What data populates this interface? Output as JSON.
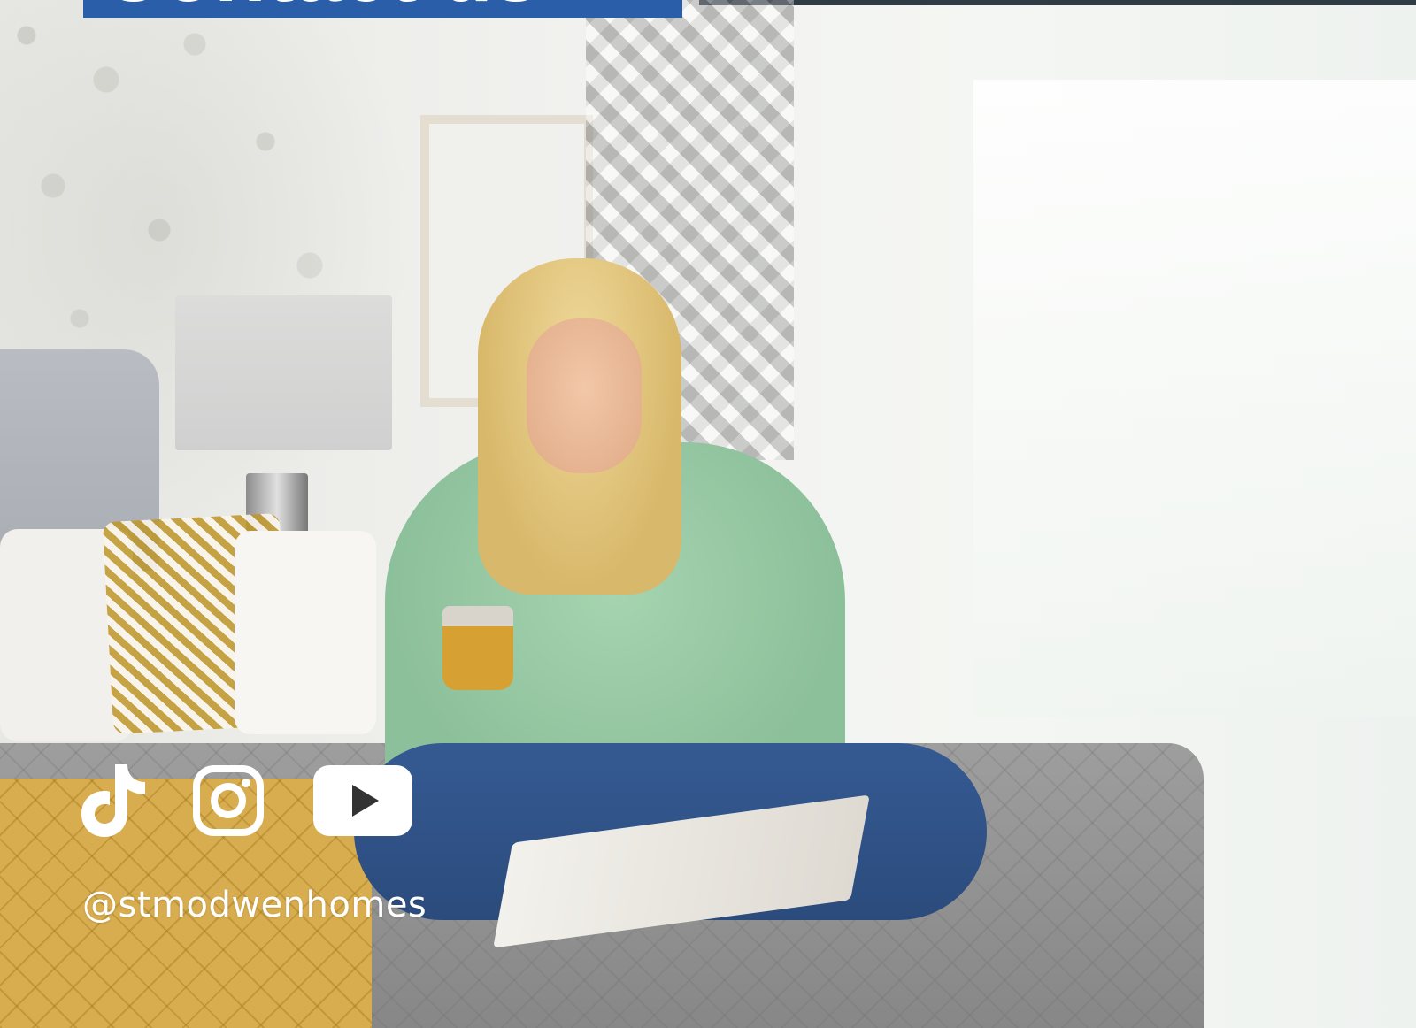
{
  "header": {
    "title": "Contact us"
  },
  "social": {
    "networks": [
      {
        "name": "TikTok",
        "icon": "tiktok-icon"
      },
      {
        "name": "Instagram",
        "icon": "instagram-icon"
      },
      {
        "name": "YouTube",
        "icon": "youtube-icon"
      }
    ],
    "handle": "@stmodwenhomes"
  },
  "colors": {
    "brand_blue": "#2a5ea8",
    "icon_white": "#ffffff"
  }
}
